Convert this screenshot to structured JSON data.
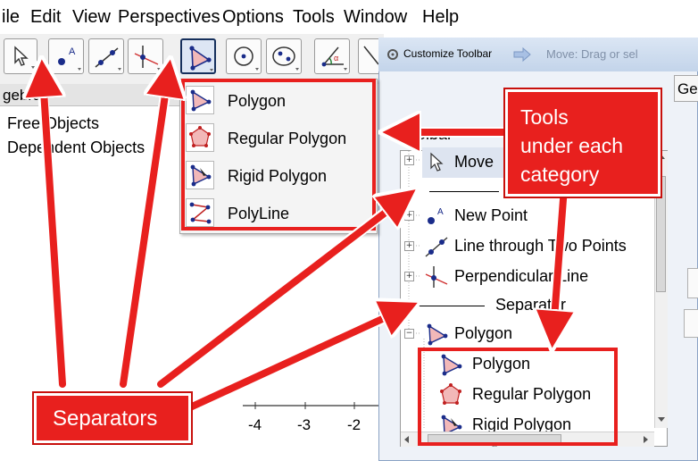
{
  "menubar": {
    "items": [
      "ile",
      "Edit",
      "View",
      "Perspectives",
      "Options",
      "Tools",
      "Window",
      "Help"
    ]
  },
  "toolbar": {
    "buttons": [
      "move-tool",
      "point-tool",
      "line-tool",
      "perpendicular-tool",
      "polygon-tool",
      "circle-tool",
      "conic-tool",
      "angle-tool",
      "reflect-tool"
    ]
  },
  "algebra": {
    "header": "gebra",
    "items": [
      "Free Objects",
      "Dependent Objects"
    ]
  },
  "graphics": {
    "x_ticks": [
      "-4",
      "-3",
      "-2"
    ]
  },
  "dropdown": {
    "items": [
      "Polygon",
      "Regular Polygon",
      "Rigid Polygon",
      "PolyLine"
    ]
  },
  "dialog": {
    "title": "Customize Toolbar",
    "toolbar_label": "Toolbar",
    "tab_label": "Ge",
    "right_field": "Move: Drag or sel",
    "scroll_marker": "III",
    "tree": [
      "Move",
      "Se",
      "New Point",
      "Line through Two Points",
      "Perpendicular Line",
      "Separator",
      "Polygon",
      "Polygon",
      "Regular Polygon",
      "Rigid Polygon"
    ]
  },
  "callouts": {
    "tools": "Tools\nunder each\ncategory",
    "separators": "Separators"
  },
  "colors": {
    "accent": "#e8201e",
    "point_blue": "#1a2c8a",
    "polygon_fill": "#e8a0a0"
  }
}
